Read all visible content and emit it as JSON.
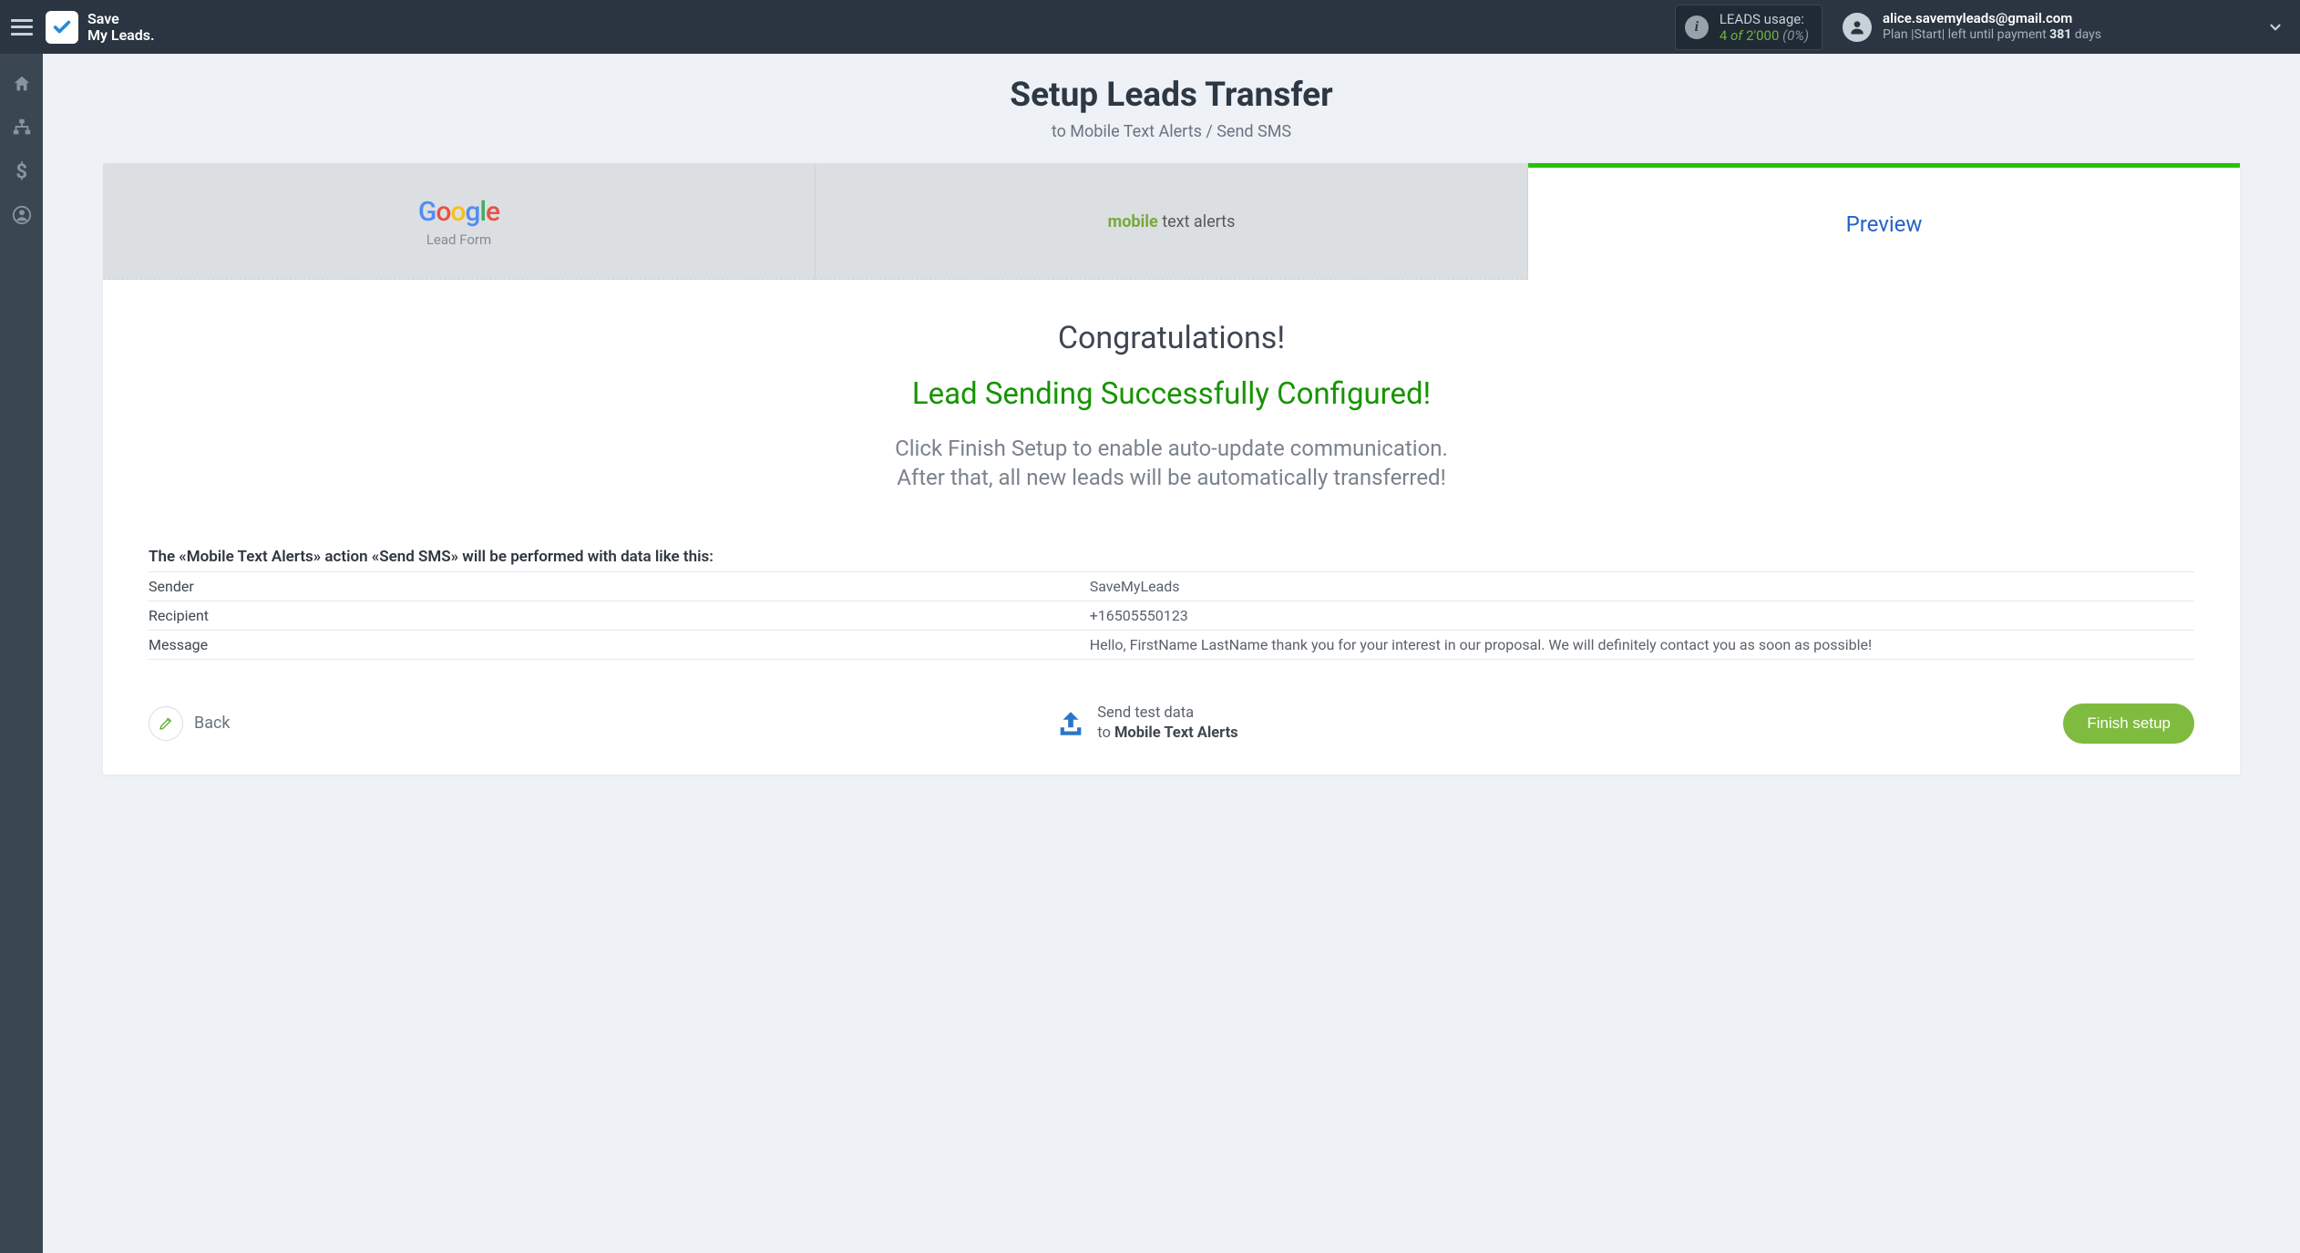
{
  "header": {
    "brand_line1": "Save",
    "brand_line2": "My Leads.",
    "usage": {
      "label": "LEADS usage:",
      "used": "4",
      "of_word": "of",
      "total": "2'000",
      "percent": "(0%)"
    },
    "account": {
      "email": "alice.savemyleads@gmail.com",
      "plan_prefix": "Plan |",
      "plan_name": "Start",
      "plan_mid": "| left until payment ",
      "days_value": "381",
      "days_suffix": " days"
    }
  },
  "page": {
    "title": "Setup Leads Transfer",
    "subtitle": "to Mobile Text Alerts / Send SMS"
  },
  "tabs": {
    "source_sub": "Lead Form",
    "dest_prefix": "mobile",
    "dest_rest": " text alerts",
    "preview": "Preview"
  },
  "content": {
    "congrats": "Congratulations!",
    "success": "Lead Sending Successfully Configured!",
    "desc_line1": "Click Finish Setup to enable auto-update communication.",
    "desc_line2": "After that, all new leads will be automatically transferred!",
    "table_intro": "The «Mobile Text Alerts» action «Send SMS» will be performed with data like this:",
    "rows": [
      {
        "key": "Sender",
        "value": "SaveMyLeads"
      },
      {
        "key": "Recipient",
        "value": "+16505550123"
      },
      {
        "key": "Message",
        "value": "Hello, FirstName LastName thank you for your interest in our proposal. We will definitely contact you as soon as possible!"
      }
    ]
  },
  "footer": {
    "back": "Back",
    "send_test_line1": "Send test data",
    "send_test_line2_prefix": "to ",
    "send_test_line2_bold": "Mobile Text Alerts",
    "finish": "Finish setup"
  }
}
